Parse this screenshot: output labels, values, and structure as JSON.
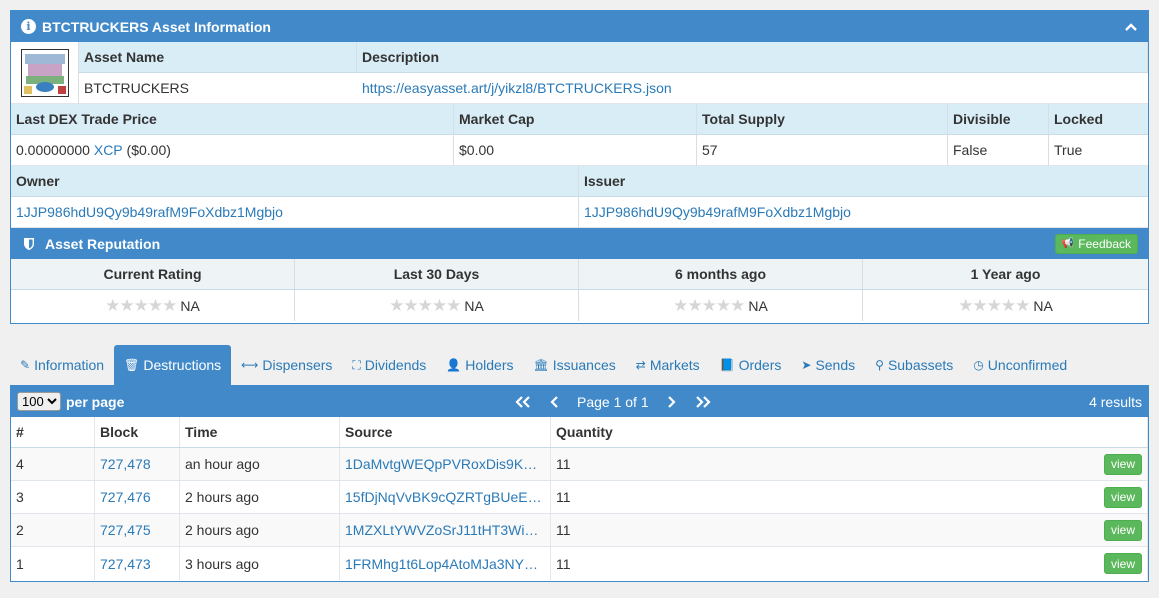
{
  "asset_panel": {
    "title": "BTCTRUCKERS Asset Information",
    "info_icon": "info-circle-icon",
    "collapse_icon": "chevron-up-icon",
    "asset_name_label": "Asset Name",
    "asset_name": "BTCTRUCKERS",
    "description_label": "Description",
    "description": "https://easyasset.art/j/yikzl8/BTCTRUCKERS.json",
    "last_dex_label": "Last DEX Trade Price",
    "last_dex_amount": "0.00000000",
    "last_dex_currency": "XCP",
    "last_dex_usd": "($0.00)",
    "market_cap_label": "Market Cap",
    "market_cap": "$0.00",
    "total_supply_label": "Total Supply",
    "total_supply": "57",
    "divisible_label": "Divisible",
    "divisible": "False",
    "locked_label": "Locked",
    "locked": "True",
    "owner_label": "Owner",
    "owner": "1JJP986hdU9Qy9b49rafM9FoXdbz1Mgbjo",
    "issuer_label": "Issuer",
    "issuer": "1JJP986hdU9Qy9b49rafM9FoXdbz1Mgbjo"
  },
  "reputation": {
    "title": "Asset Reputation",
    "feedback_label": "Feedback",
    "ratings": [
      {
        "label": "Current Rating",
        "stars": "★★★★★",
        "value": "NA"
      },
      {
        "label": "Last 30 Days",
        "stars": "★★★★★",
        "value": "NA"
      },
      {
        "label": "6 months ago",
        "stars": "★★★★★",
        "value": "NA"
      },
      {
        "label": "1 Year ago",
        "stars": "★★★★★",
        "value": "NA"
      }
    ]
  },
  "tabs": [
    {
      "label": "Information",
      "icon": "✎"
    },
    {
      "label": "Destructions",
      "icon": "🗑"
    },
    {
      "label": "Dispensers",
      "icon": "⟷"
    },
    {
      "label": "Dividends",
      "icon": "⛶"
    },
    {
      "label": "Holders",
      "icon": "👤"
    },
    {
      "label": "Issuances",
      "icon": "🏛"
    },
    {
      "label": "Markets",
      "icon": "⇄"
    },
    {
      "label": "Orders",
      "icon": "📘"
    },
    {
      "label": "Sends",
      "icon": "➤"
    },
    {
      "label": "Subassets",
      "icon": "⚲"
    },
    {
      "label": "Unconfirmed",
      "icon": "◷"
    }
  ],
  "active_tab": "Destructions",
  "destructions": {
    "per_page_value": "100",
    "per_page_label": "per page",
    "first_page": "<<",
    "prev_page": "<",
    "page_label": "Page 1 of 1",
    "next_page": ">",
    "last_page": ">>",
    "results": "4 results",
    "columns": [
      "#",
      "Block",
      "Time",
      "Source",
      "Quantity"
    ],
    "rows": [
      {
        "num": "4",
        "block": "727,478",
        "time": "an hour ago",
        "source": "1DaMvtgWEQpPVRoxDis9KT…",
        "quantity": "11",
        "action": "view"
      },
      {
        "num": "3",
        "block": "727,476",
        "time": "2 hours ago",
        "source": "15fDjNqVvBK9cQZRTgBUeE…",
        "quantity": "11",
        "action": "view"
      },
      {
        "num": "2",
        "block": "727,475",
        "time": "2 hours ago",
        "source": "1MZXLtYWVZoSrJ11tHT3Wi…",
        "quantity": "11",
        "action": "view"
      },
      {
        "num": "1",
        "block": "727,473",
        "time": "3 hours ago",
        "source": "1FRMhg1t6Lop4AtoMJa3NY…",
        "quantity": "11",
        "action": "view"
      }
    ]
  }
}
